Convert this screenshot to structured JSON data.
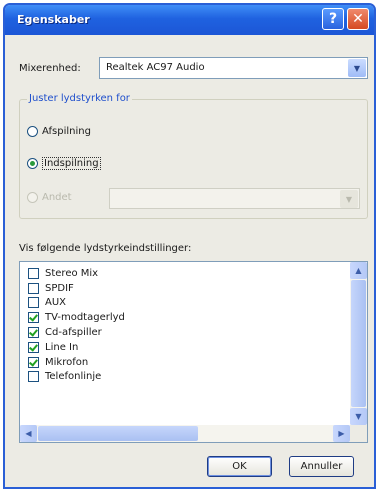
{
  "window": {
    "title": "Egenskaber",
    "help_glyph": "?",
    "close_glyph": "✕"
  },
  "device": {
    "label": "Mixerenhed:",
    "value": "Realtek AC97 Audio"
  },
  "volume_group": {
    "legend": "Juster lydstyrken for",
    "options": [
      {
        "label": "Afspilning",
        "selected": false,
        "disabled": false
      },
      {
        "label": "Indspilning",
        "selected": true,
        "disabled": false
      },
      {
        "label": "Andet",
        "selected": false,
        "disabled": true
      }
    ]
  },
  "controls": {
    "label": "Vis følgende lydstyrkeindstillinger:",
    "items": [
      {
        "label": "Stereo Mix",
        "checked": false
      },
      {
        "label": "SPDIF",
        "checked": false
      },
      {
        "label": "AUX",
        "checked": false
      },
      {
        "label": "TV-modtagerlyd",
        "checked": true
      },
      {
        "label": "Cd-afspiller",
        "checked": true
      },
      {
        "label": "Line In",
        "checked": true
      },
      {
        "label": "Mikrofon",
        "checked": true
      },
      {
        "label": "Telefonlinje",
        "checked": false
      }
    ]
  },
  "buttons": {
    "ok": "OK",
    "cancel": "Annuller"
  },
  "icons": {
    "dropdown": "chevron-down-icon",
    "scroll_up": "arrow-up-icon",
    "scroll_down": "arrow-down-icon",
    "scroll_left": "arrow-left-icon",
    "scroll_right": "arrow-right-icon"
  },
  "colors": {
    "titlebar": "#1f62e0",
    "close_button": "#d54a22",
    "legend_text": "#1f4fcc",
    "check": "#21a121"
  }
}
